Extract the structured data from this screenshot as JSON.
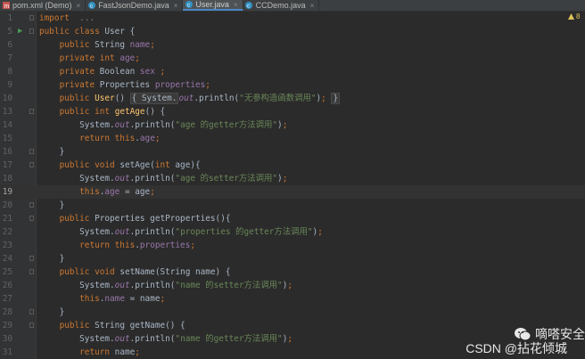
{
  "tabs": [
    {
      "label": "pom.xml (Demo)",
      "icon": "maven-icon",
      "active": false
    },
    {
      "label": "FastJsonDemo.java",
      "icon": "class-icon",
      "active": false
    },
    {
      "label": "User.java",
      "icon": "class-icon",
      "active": true
    },
    {
      "label": "CCDemo.java",
      "icon": "class-icon",
      "active": false
    }
  ],
  "inspection": {
    "count": "8"
  },
  "editor": {
    "lines": [
      {
        "no": "1",
        "tokens": [
          [
            "k",
            "import"
          ],
          [
            "",
            "  "
          ],
          [
            "dim",
            "..."
          ]
        ]
      },
      {
        "no": "5",
        "tokens": [
          [
            "k",
            "public class"
          ],
          [
            "",
            " User {"
          ]
        ]
      },
      {
        "no": "6",
        "tokens": [
          [
            "",
            "    "
          ],
          [
            "k",
            "public"
          ],
          [
            "",
            " String "
          ],
          [
            "f",
            "name"
          ],
          [
            "k",
            ";"
          ]
        ]
      },
      {
        "no": "7",
        "tokens": [
          [
            "",
            "    "
          ],
          [
            "k",
            "private int"
          ],
          [
            "",
            " "
          ],
          [
            "f",
            "age"
          ],
          [
            "k",
            ";"
          ]
        ]
      },
      {
        "no": "8",
        "tokens": [
          [
            "",
            "    "
          ],
          [
            "k",
            "private"
          ],
          [
            "",
            " Boolean "
          ],
          [
            "f",
            "sex "
          ],
          [
            "k",
            ";"
          ]
        ]
      },
      {
        "no": "9",
        "tokens": [
          [
            "",
            "    "
          ],
          [
            "k",
            "private"
          ],
          [
            "",
            " Properties "
          ],
          [
            "f",
            "properties"
          ],
          [
            "k",
            ";"
          ]
        ]
      },
      {
        "no": "10",
        "tokens": [
          [
            "",
            "    "
          ],
          [
            "k",
            "public"
          ],
          [
            "",
            " "
          ],
          [
            "m",
            "User"
          ],
          [
            "",
            "() "
          ],
          [
            "fold-inline",
            "{ System."
          ],
          [
            "fi",
            "out"
          ],
          [
            "",
            ".println("
          ],
          [
            "s",
            "\"无参构造函数调用\""
          ],
          [
            "",
            ")"
          ],
          [
            "k",
            ";"
          ],
          [
            "",
            " "
          ],
          [
            "fold-inline",
            "}"
          ]
        ]
      },
      {
        "no": "13",
        "tokens": [
          [
            "",
            "    "
          ],
          [
            "k",
            "public int"
          ],
          [
            "",
            " "
          ],
          [
            "m",
            "getAge"
          ],
          [
            "",
            "() {"
          ]
        ]
      },
      {
        "no": "14",
        "tokens": [
          [
            "",
            "        System."
          ],
          [
            "fi",
            "out"
          ],
          [
            "",
            ".println("
          ],
          [
            "s",
            "\"age 的getter方法调用\""
          ],
          [
            "",
            ")"
          ],
          [
            "k",
            ";"
          ]
        ]
      },
      {
        "no": "15",
        "tokens": [
          [
            "",
            "        "
          ],
          [
            "k",
            "return this"
          ],
          [
            "",
            "."
          ],
          [
            "f",
            "age"
          ],
          [
            "k",
            ";"
          ]
        ]
      },
      {
        "no": "16",
        "tokens": [
          [
            "",
            "    }"
          ]
        ]
      },
      {
        "no": "17",
        "tokens": [
          [
            "",
            "    "
          ],
          [
            "k",
            "public void"
          ],
          [
            "",
            " setAge("
          ],
          [
            "k",
            "int"
          ],
          [
            "",
            " age){"
          ]
        ]
      },
      {
        "no": "18",
        "tokens": [
          [
            "",
            "        System."
          ],
          [
            "fi",
            "out"
          ],
          [
            "",
            ".println("
          ],
          [
            "s",
            "\"age 的setter方法调用\""
          ],
          [
            "",
            ")"
          ],
          [
            "k",
            ";"
          ]
        ]
      },
      {
        "no": "19",
        "tokens": [
          [
            "",
            "        "
          ],
          [
            "k",
            "this"
          ],
          [
            "",
            "."
          ],
          [
            "f",
            "age"
          ],
          [
            "",
            " = age"
          ],
          [
            "k",
            ";"
          ]
        ]
      },
      {
        "no": "20",
        "tokens": [
          [
            "",
            "    }"
          ]
        ]
      },
      {
        "no": "21",
        "tokens": [
          [
            "",
            "    "
          ],
          [
            "k",
            "public"
          ],
          [
            "",
            " Properties getProperties(){"
          ]
        ]
      },
      {
        "no": "22",
        "tokens": [
          [
            "",
            "        System."
          ],
          [
            "fi",
            "out"
          ],
          [
            "",
            ".println("
          ],
          [
            "s",
            "\"properties 的getter方法调用\""
          ],
          [
            "",
            ")"
          ],
          [
            "k",
            ";"
          ]
        ]
      },
      {
        "no": "23",
        "tokens": [
          [
            "",
            "        "
          ],
          [
            "k",
            "return this"
          ],
          [
            "",
            "."
          ],
          [
            "f",
            "properties"
          ],
          [
            "k",
            ";"
          ]
        ]
      },
      {
        "no": "24",
        "tokens": [
          [
            "",
            "    }"
          ]
        ]
      },
      {
        "no": "25",
        "tokens": [
          [
            "",
            "    "
          ],
          [
            "k",
            "public void"
          ],
          [
            "",
            " setName(String name) {"
          ]
        ]
      },
      {
        "no": "26",
        "tokens": [
          [
            "",
            "        System."
          ],
          [
            "fi",
            "out"
          ],
          [
            "",
            ".println("
          ],
          [
            "s",
            "\"name 的setter方法调用\""
          ],
          [
            "",
            ")"
          ],
          [
            "k",
            ";"
          ]
        ]
      },
      {
        "no": "27",
        "tokens": [
          [
            "",
            "        "
          ],
          [
            "k",
            "this"
          ],
          [
            "",
            "."
          ],
          [
            "f",
            "name"
          ],
          [
            "",
            " = name"
          ],
          [
            "k",
            ";"
          ]
        ]
      },
      {
        "no": "28",
        "tokens": [
          [
            "",
            "    }"
          ]
        ]
      },
      {
        "no": "29",
        "tokens": [
          [
            "",
            "    "
          ],
          [
            "k",
            "public"
          ],
          [
            "",
            " String getName() {"
          ]
        ]
      },
      {
        "no": "30",
        "tokens": [
          [
            "",
            "        System."
          ],
          [
            "fi",
            "out"
          ],
          [
            "",
            ".println("
          ],
          [
            "s",
            "\"name 的getter方法调用\""
          ],
          [
            "",
            ")"
          ],
          [
            "k",
            ";"
          ]
        ]
      },
      {
        "no": "31",
        "tokens": [
          [
            "",
            "        "
          ],
          [
            "k",
            "return"
          ],
          [
            "",
            " name"
          ],
          [
            "k",
            ";"
          ]
        ]
      }
    ]
  },
  "watermark": {
    "top": "嘀嗒安全",
    "bottom": "CSDN @拈花倾城"
  }
}
